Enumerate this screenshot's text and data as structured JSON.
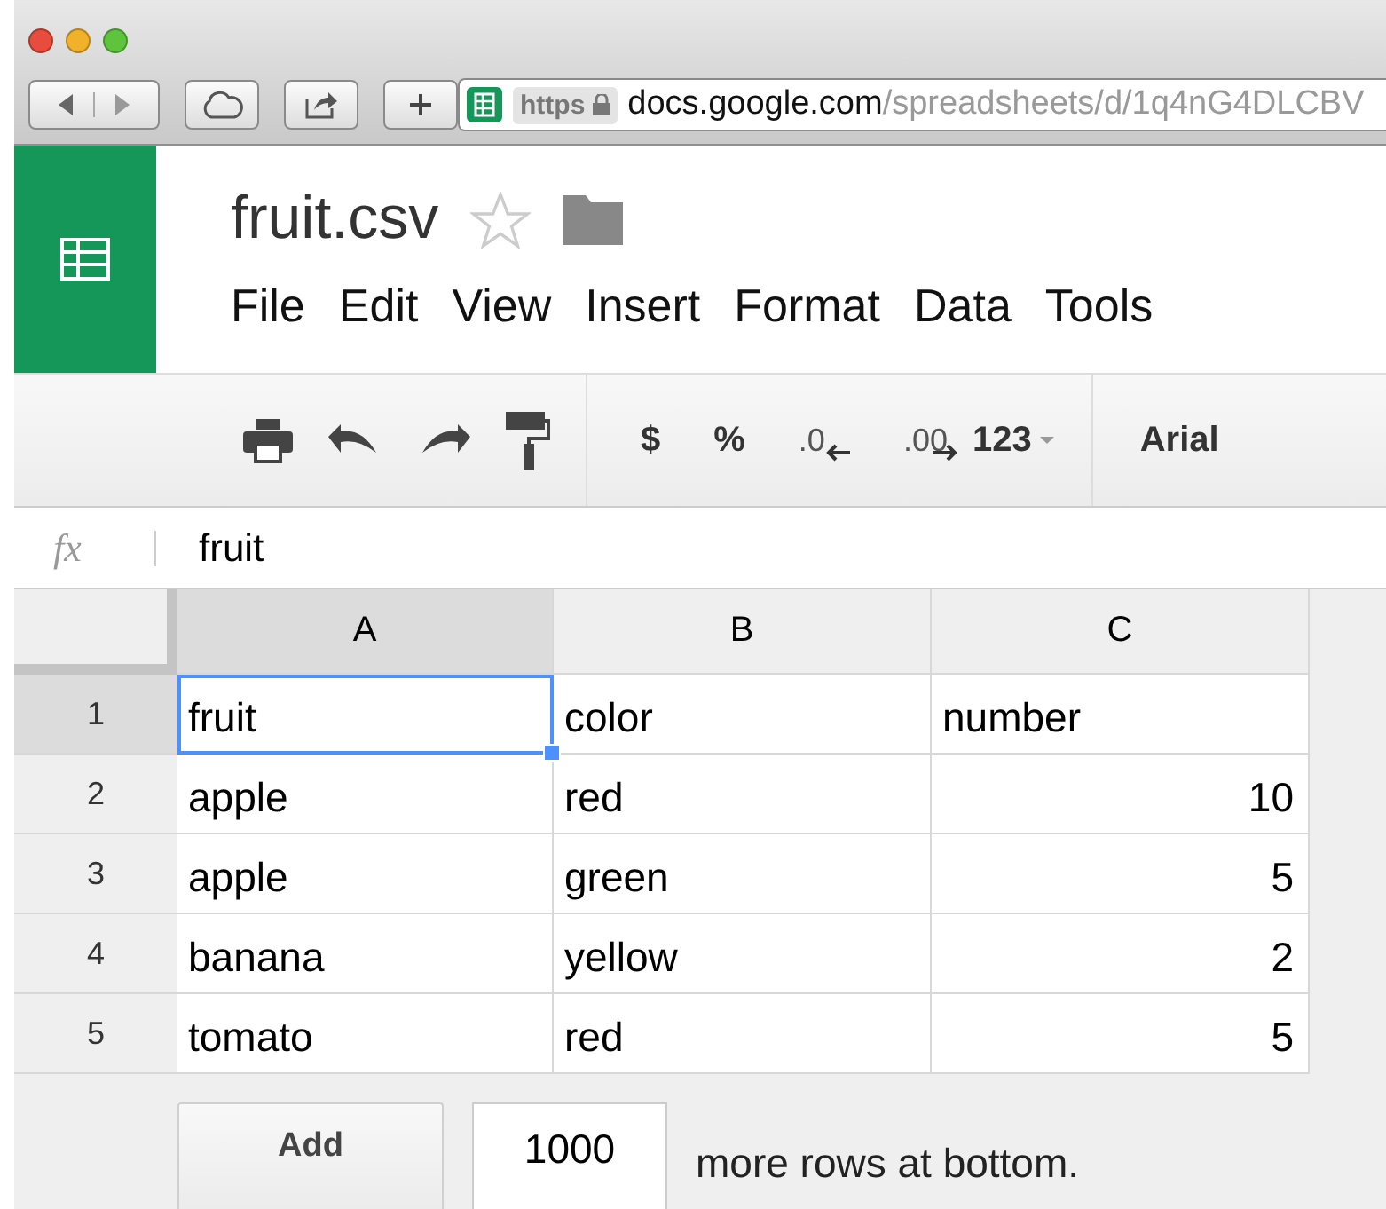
{
  "browser": {
    "scheme": "https",
    "host": "docs.google.com",
    "path": "/spreadsheets/d/1q4nG4DLCBV"
  },
  "document": {
    "title": "fruit.csv",
    "starred": false
  },
  "menu": [
    "File",
    "Edit",
    "View",
    "Insert",
    "Format",
    "Data",
    "Tools"
  ],
  "toolbar": {
    "currency": "$",
    "percent": "%",
    "decrease_decimals": ".0",
    "increase_decimals": ".00",
    "number_format": "123",
    "font": "Arial"
  },
  "formula_bar": {
    "label": "fx",
    "value": "fruit"
  },
  "table": {
    "columns": [
      {
        "label": "A",
        "selected": true
      },
      {
        "label": "B",
        "selected": false
      },
      {
        "label": "C",
        "selected": false
      }
    ],
    "rows": [
      {
        "label": "1",
        "selected": true,
        "cells": [
          {
            "text": "fruit",
            "kind": "text",
            "selected": true
          },
          {
            "text": "color",
            "kind": "text",
            "selected": false
          },
          {
            "text": "number",
            "kind": "text",
            "selected": false
          }
        ]
      },
      {
        "label": "2",
        "selected": false,
        "cells": [
          {
            "text": "apple",
            "kind": "text",
            "selected": false
          },
          {
            "text": "red",
            "kind": "text",
            "selected": false
          },
          {
            "text": "10",
            "kind": "number",
            "selected": false
          }
        ]
      },
      {
        "label": "3",
        "selected": false,
        "cells": [
          {
            "text": "apple",
            "kind": "text",
            "selected": false
          },
          {
            "text": "green",
            "kind": "text",
            "selected": false
          },
          {
            "text": "5",
            "kind": "number",
            "selected": false
          }
        ]
      },
      {
        "label": "4",
        "selected": false,
        "cells": [
          {
            "text": "banana",
            "kind": "text",
            "selected": false
          },
          {
            "text": "yellow",
            "kind": "text",
            "selected": false
          },
          {
            "text": "2",
            "kind": "number",
            "selected": false
          }
        ]
      },
      {
        "label": "5",
        "selected": false,
        "cells": [
          {
            "text": "tomato",
            "kind": "text",
            "selected": false
          },
          {
            "text": "red",
            "kind": "text",
            "selected": false
          },
          {
            "text": "5",
            "kind": "number",
            "selected": false
          }
        ]
      }
    ]
  },
  "add_rows": {
    "button": "Add",
    "count": "1000",
    "suffix": "more rows at bottom."
  }
}
